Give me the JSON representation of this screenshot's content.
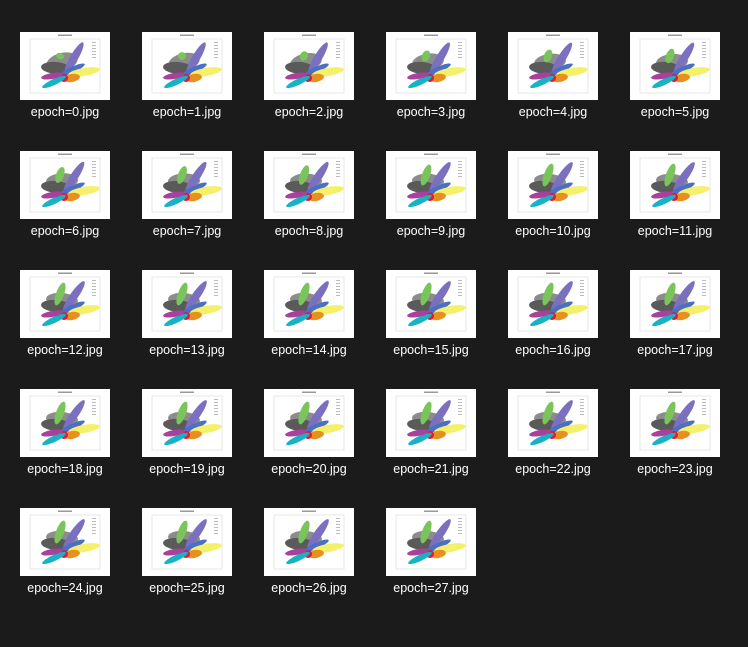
{
  "folder": {
    "files": [
      {
        "name": "epoch=0.jpg"
      },
      {
        "name": "epoch=1.jpg"
      },
      {
        "name": "epoch=2.jpg"
      },
      {
        "name": "epoch=3.jpg"
      },
      {
        "name": "epoch=4.jpg"
      },
      {
        "name": "epoch=5.jpg"
      },
      {
        "name": "epoch=6.jpg"
      },
      {
        "name": "epoch=7.jpg"
      },
      {
        "name": "epoch=8.jpg"
      },
      {
        "name": "epoch=9.jpg"
      },
      {
        "name": "epoch=10.jpg"
      },
      {
        "name": "epoch=11.jpg"
      },
      {
        "name": "epoch=12.jpg"
      },
      {
        "name": "epoch=13.jpg"
      },
      {
        "name": "epoch=14.jpg"
      },
      {
        "name": "epoch=15.jpg"
      },
      {
        "name": "epoch=16.jpg"
      },
      {
        "name": "epoch=17.jpg"
      },
      {
        "name": "epoch=18.jpg"
      },
      {
        "name": "epoch=19.jpg"
      },
      {
        "name": "epoch=20.jpg"
      },
      {
        "name": "epoch=21.jpg"
      },
      {
        "name": "epoch=22.jpg"
      },
      {
        "name": "epoch=23.jpg"
      },
      {
        "name": "epoch=24.jpg"
      },
      {
        "name": "epoch=25.jpg"
      },
      {
        "name": "epoch=26.jpg"
      },
      {
        "name": "epoch=27.jpg"
      }
    ]
  },
  "colors": {
    "background": "#1b1b1b",
    "label": "#ffffff",
    "thumbnail": "#ffffff",
    "clusters": [
      "#5a5a5a",
      "#8c8c8c",
      "#7b6fbf",
      "#4a6fc4",
      "#f5f06a",
      "#e8901f",
      "#d81e3c",
      "#17b3c4",
      "#a8409c",
      "#7ac55a"
    ]
  }
}
